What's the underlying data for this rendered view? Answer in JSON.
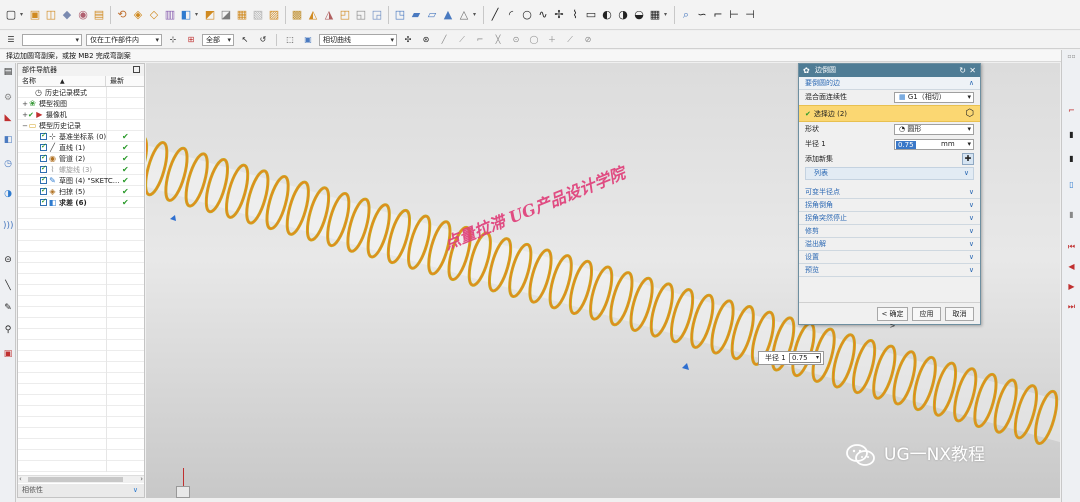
{
  "status_line": "择边加圆弯副案，或按 MB2 完成弯副案",
  "toolbar2": {
    "filter_type": "",
    "scope": "仅在工作部件内",
    "selection_scope": "全部",
    "curve_rule": "相切曲线"
  },
  "navigator": {
    "title": "部件导航器",
    "col_name": "名称",
    "col_latest": "最新",
    "items": [
      {
        "label": "历史记录模式",
        "indent": 1,
        "icon": "clock-icon",
        "check": false,
        "ok": false,
        "style": ""
      },
      {
        "label": "模型视图",
        "indent": 0,
        "icon": "views-icon",
        "check": false,
        "ok": false,
        "style": ""
      },
      {
        "label": "摄像机",
        "indent": 0,
        "icon": "camera-icon",
        "check": false,
        "ok": false,
        "style": ""
      },
      {
        "label": "模型历史记录",
        "indent": 0,
        "icon": "folder-icon",
        "check": false,
        "ok": false,
        "style": ""
      },
      {
        "label": "基准坐标系 (0)",
        "indent": 2,
        "icon": "csys-icon",
        "check": true,
        "ok": true,
        "style": ""
      },
      {
        "label": "直线 (1)",
        "indent": 2,
        "icon": "line-icon",
        "check": true,
        "ok": true,
        "style": ""
      },
      {
        "label": "管道 (2)",
        "indent": 2,
        "icon": "tube-icon",
        "check": true,
        "ok": true,
        "style": ""
      },
      {
        "label": "螺旋线 (3)",
        "indent": 2,
        "icon": "helix-icon",
        "check": true,
        "ok": true,
        "style": "dim"
      },
      {
        "label": "草图 (4) \"SKETC...",
        "indent": 2,
        "icon": "sketch-icon",
        "check": true,
        "ok": true,
        "style": ""
      },
      {
        "label": "扫掠 (5)",
        "indent": 2,
        "icon": "sweep-icon",
        "check": true,
        "ok": true,
        "style": ""
      },
      {
        "label": "求差 (6)",
        "indent": 2,
        "icon": "subtract-icon",
        "check": true,
        "ok": true,
        "style": "bold"
      }
    ],
    "footer": "相依性"
  },
  "dialog": {
    "title": "边倒圆",
    "section_edges": "要倒圆的边",
    "continuity_label": "混合面连续性",
    "continuity_value": "G1（相切）",
    "select_edge_label": "选择边 (2)",
    "shape_label": "形状",
    "shape_value": "圆形",
    "radius_label": "半径 1",
    "radius_value": "0.75",
    "radius_unit": "mm",
    "add_set_label": "添加新集",
    "list_label": "列表",
    "collapsed_sections": [
      "可变半径点",
      "拐角倒角",
      "拐角突然停止",
      "修剪",
      "溢出解",
      "设置",
      "预览"
    ],
    "ok_button": "< 确定 >",
    "apply_button": "应用",
    "cancel_button": "取消"
  },
  "callout": {
    "label": "半径 1",
    "value": "0.75"
  },
  "watermarks": {
    "red": "点量拉滞 UG产品设计学院",
    "brand": "UG一NX教程"
  }
}
